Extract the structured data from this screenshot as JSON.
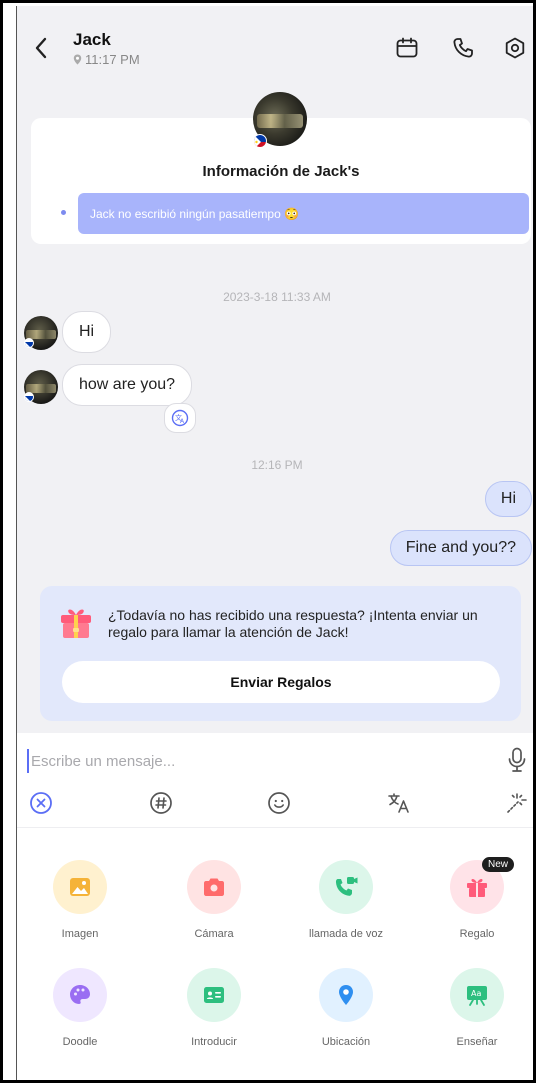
{
  "header": {
    "title": "Jack",
    "local_time": "11:17 PM"
  },
  "profile": {
    "info_title": "Información de Jack's",
    "hobby_text": "Jack no escribió ningún pasatiempo 😳"
  },
  "chat": {
    "timestamp_1": "2023-3-18 11:33 AM",
    "incoming": [
      {
        "text": "Hi"
      },
      {
        "text": "how are you?"
      }
    ],
    "timestamp_2": "12:16 PM",
    "outgoing": [
      {
        "text": "Hi"
      },
      {
        "text": "Fine and you??"
      }
    ]
  },
  "gift_prompt": {
    "text": "¿Todavía no has recibido una respuesta? ¡Intenta enviar un regalo para llamar la atención de Jack!",
    "button_label": "Enviar Regalos"
  },
  "composer": {
    "placeholder": "Escribe un mensaje..."
  },
  "attachments": [
    {
      "label": "Imagen",
      "icon": "image-icon",
      "color": "#fff1cf"
    },
    {
      "label": "Cámara",
      "icon": "camera-icon",
      "color": "#ffe3e3"
    },
    {
      "label": "llamada de voz",
      "icon": "voice-call-icon",
      "color": "#dcf6ea"
    },
    {
      "label": "Regalo",
      "icon": "gift-icon",
      "color": "#ffe3e8",
      "badge": "New"
    },
    {
      "label": "Doodle",
      "icon": "palette-icon",
      "color": "#efe7ff"
    },
    {
      "label": "Introducir",
      "icon": "contact-card-icon",
      "color": "#dcf6ea"
    },
    {
      "label": "Ubicación",
      "icon": "location-icon",
      "color": "#e1f1ff"
    },
    {
      "label": "Enseñar",
      "icon": "teach-icon",
      "color": "#dcf6ea"
    }
  ],
  "colors": {
    "accent": "#5b6ef5",
    "outgoing_bubble": "#dbe3fc",
    "hobby_box": "#a8b4fb"
  }
}
